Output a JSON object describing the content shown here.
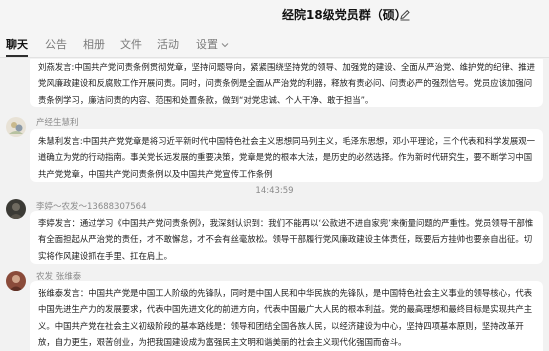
{
  "window": {
    "title": "经院18级党员群（硕）",
    "edit_icon": "pencil-icon"
  },
  "tabs": [
    {
      "label": "聊天",
      "active": true
    },
    {
      "label": "公告",
      "active": false
    },
    {
      "label": "相册",
      "active": false
    },
    {
      "label": "文件",
      "active": false
    },
    {
      "label": "活动",
      "active": false
    },
    {
      "label": "设置",
      "active": false
    }
  ],
  "messages": [
    {
      "sender": "",
      "avatar": "",
      "text": "刘燕发言:中国共产党问责条例贯彻党章，坚持问题导向，紧紧围绕坚持党的领导、加强党的建设、全面从严治党、维护党的纪律、推进党风廉政建设和反腐败工作开展问责。同时，问责条例是全面从严治党的利器，释放有责必问、问责必严的强烈信号。党员应该加强问责条例学习，廉洁问责的内容、范围和处置条款，做到“对党忠诚、个人干净、敢于担当”。"
    },
    {
      "sender": "产经生慧利",
      "avatar": "",
      "text": "朱慧利发言:中国共产党党章是将习近平新时代中国特色社会主义思想同马列主义，毛泽东思想，邓小平理论，三个代表和科学发展观一道确立为党的行动指南。事关党长远发展的重要决策，党章是党的根本大法，是历史的必然选择。作为新时代研究生，要不断学习中国共产党党章，中国共产党问责条例以及中国共产党宣传工作条例"
    },
    {
      "timestamp": "14:43:59"
    },
    {
      "sender": "李婷～农发～13688307564",
      "avatar": "",
      "text": "李婷发言：通过学习《中国共产党问责条例》，我深刻认识到：我们不能再以‘公款进不进自家兜’来衡量问题的严重性。党员领导干部惟有全面担起从严治党的责任，才不敢懈怠，才不会有丝毫放松。领导干部履行党风廉政建设主体责任，既要后方挂帅也要亲自出征。切实将作风建设抓在手里、扛在肩上。"
    },
    {
      "sender": "农发 张维泰",
      "avatar": "",
      "text": "张维泰发言：中国共产党是中国工人阶级的先锋队，同时是中国人民和中华民族的先锋队，是中国特色社会主义事业的领导核心，代表中国先进生产力的发展要求，代表中国先进文化的前进方向，代表中国最广大人民的根本利益。党的最高理想和最终目标是实现共产主义。中国共产党在社会主义初级阶段的基本路线是：领导和团结全国各族人民，以经济建设为中心，坚持四项基本原则，坚持改革开放，自力更生，艰苦创业，为把我国建设成为富强民主文明和谐美丽的社会主义现代化强国而奋斗。"
    }
  ],
  "colors": {
    "background": "#f2f2f2",
    "bubble": "#ffffff",
    "meta_text": "#8a8a8a"
  }
}
